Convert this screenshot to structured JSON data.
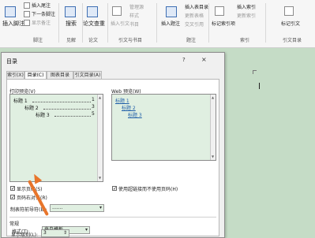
{
  "ribbon": {
    "insert_footnote": "插入脚注",
    "insert_endnote": "插入尾注",
    "next_footnote": "下一条脚注",
    "show_notes": "显示备注",
    "footnotes_group": "脚注",
    "search": "搜索",
    "insights_group": "见解",
    "researcher": "论文查重",
    "research_group": "论文",
    "insert_citation": "插入引文",
    "manage_sources": "管理源",
    "style": "样式",
    "bibliography": "书目",
    "citations_group": "引文与书目",
    "insert_caption": "插入题注",
    "insert_table_of_figures": "插入表目录",
    "update_table": "更新表格",
    "cross_reference": "交叉引用",
    "captions_group": "题注",
    "mark_entry": "标记索引项",
    "insert_index": "插入索引",
    "update_index": "更新索引",
    "index_group": "索引",
    "mark_citation": "标记引文",
    "table_of_authorities_group": "引文目录"
  },
  "dialog": {
    "title": "目录",
    "help": "?",
    "close": "×",
    "tabs": [
      "索引(X)",
      "目录(C)",
      "图表目录(F)",
      "引文目录(A)"
    ],
    "active_tab": 1,
    "print_preview_label": "打印预览(V)",
    "web_preview_label": "Web 预览(W)",
    "print_preview": [
      {
        "text": "标题 1",
        "page": "1"
      },
      {
        "text": "标题 2",
        "page": "3"
      },
      {
        "text": "标题 3",
        "page": "5"
      }
    ],
    "web_preview": [
      "标题 1",
      "标题 2",
      "标题 3"
    ],
    "show_page_numbers": {
      "label": "显示页码(S)",
      "checked": true
    },
    "right_align": {
      "label": "页码右对齐(R)",
      "checked": true
    },
    "tab_leader": {
      "label": "制表符前导符(B):",
      "value": "......."
    },
    "use_hyperlinks": {
      "label": "使用超链接而不使用页码(H)",
      "checked": true
    },
    "general_label": "常规",
    "formats": {
      "label": "格式(T):",
      "value": "来自模板"
    },
    "show_levels": {
      "label": "显示级别(L):",
      "value": "3"
    }
  },
  "colors": {
    "document_bg": "#c5dcc6",
    "preview_bg": "#e0efe1",
    "arrow": "#e8752b",
    "link": "#1f5ea8"
  }
}
